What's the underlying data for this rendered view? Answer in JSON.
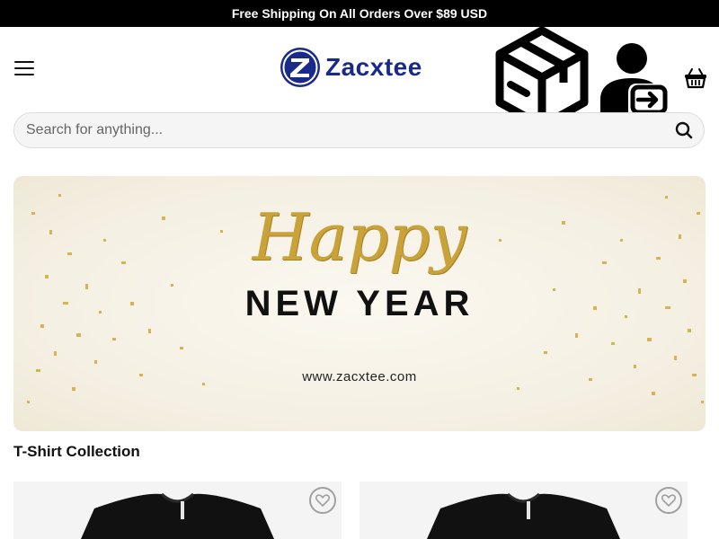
{
  "announcement": {
    "text": "Free Shipping On All Orders Over $89 USD"
  },
  "header": {
    "menu_icon": "hamburger-menu-icon",
    "logo": {
      "text": "Zacxtee",
      "mark_letter": "Z",
      "color": "#1a2a8a"
    },
    "icons": [
      "package-box-icon",
      "user-login-icon",
      "shopping-basket-icon"
    ]
  },
  "search": {
    "placeholder": "Search for anything...",
    "value": "",
    "icon": "search-icon"
  },
  "banner": {
    "script_text": "Happy",
    "title": "NEW YEAR",
    "url": "www.zacxtee.com",
    "accent_color": "#c9a33a"
  },
  "collection": {
    "title": "T-Shirt Collection",
    "products": [
      {
        "image": "black-tshirt",
        "wishlist_icon": "heart-icon"
      },
      {
        "image": "black-tshirt",
        "wishlist_icon": "heart-icon"
      }
    ]
  }
}
